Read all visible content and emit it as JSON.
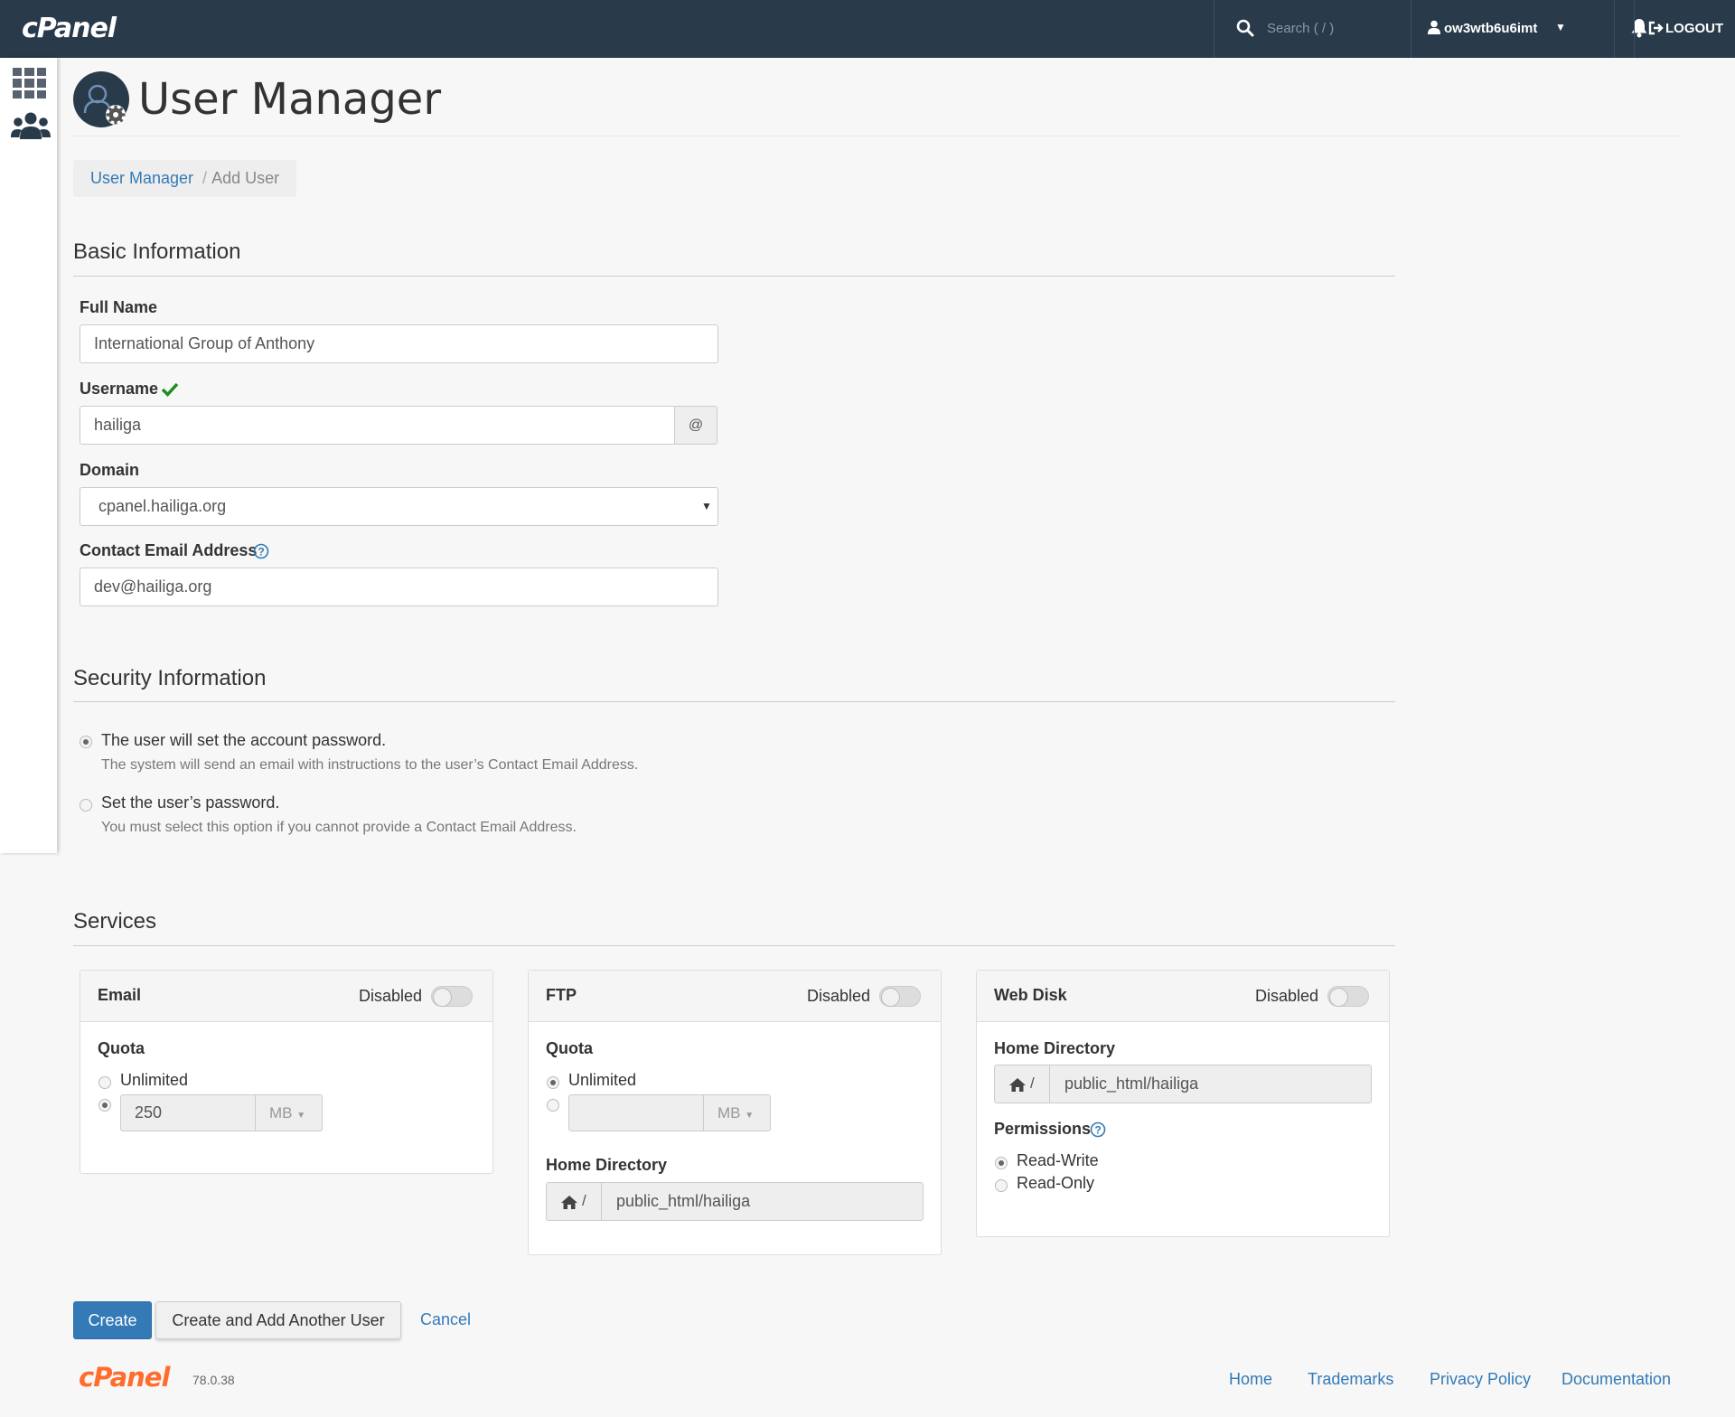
{
  "topbar": {
    "logo": "cPanel",
    "search_placeholder": "Search ( / )",
    "username": "ow3wtb6u6imt",
    "logout_label": "LOGOUT"
  },
  "page": {
    "title": "User Manager",
    "breadcrumb": {
      "parent": "User Manager",
      "separator": "/",
      "current": "Add User"
    }
  },
  "basic": {
    "heading": "Basic Information",
    "full_name_label": "Full Name",
    "full_name_value": "International Group of Anthony",
    "username_label": "Username",
    "username_value": "hailiga",
    "username_addon": "@",
    "domain_label": "Domain",
    "domain_value": "cpanel.hailiga.org",
    "email_label": "Contact Email Address",
    "email_value": "dev@hailiga.org"
  },
  "security": {
    "heading": "Security Information",
    "option1_label": "The user will set the account password.",
    "option1_help": "The system will send an email with instructions to the user’s Contact Email Address.",
    "option2_label": "Set the user’s password.",
    "option2_help": "You must select this option if you cannot provide a Contact Email Address.",
    "selected": 1
  },
  "services": {
    "heading": "Services",
    "email": {
      "title": "Email",
      "status": "Disabled",
      "quota_label": "Quota",
      "unlimited_label": "Unlimited",
      "quota_value": "250",
      "unit": "MB"
    },
    "ftp": {
      "title": "FTP",
      "status": "Disabled",
      "quota_label": "Quota",
      "unlimited_label": "Unlimited",
      "quota_value": "",
      "unit": "MB",
      "home_label": "Home Directory",
      "home_prefix": "/",
      "home_value": "public_html/hailiga"
    },
    "webdisk": {
      "title": "Web Disk",
      "status": "Disabled",
      "home_label": "Home Directory",
      "home_prefix": "/",
      "home_value": "public_html/hailiga",
      "permissions_label": "Permissions",
      "perm_rw": "Read-Write",
      "perm_ro": "Read-Only"
    }
  },
  "actions": {
    "create": "Create",
    "create_another": "Create and Add Another User",
    "cancel": "Cancel"
  },
  "footer": {
    "logo": "cPanel",
    "version": "78.0.38",
    "links": [
      "Home",
      "Trademarks",
      "Privacy Policy",
      "Documentation"
    ]
  },
  "colors": {
    "topbar": "#293a4a",
    "link": "#337ab7",
    "primary": "#337ab7",
    "brand_orange": "#ff6c2c",
    "valid_check": "#1e8c1e"
  }
}
